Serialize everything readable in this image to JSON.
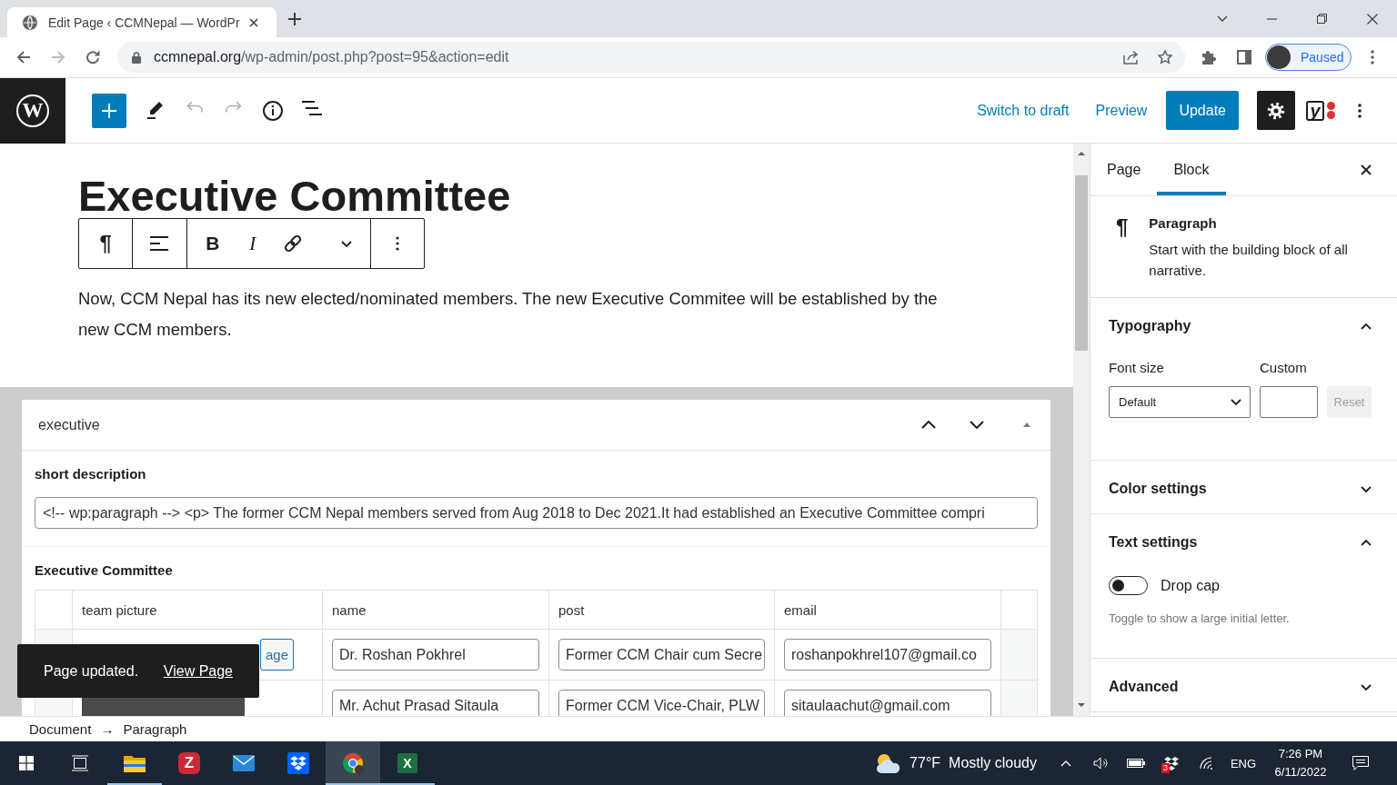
{
  "browser": {
    "tabs": [
      {
        "title": "Edit Page ‹ CCMNepal — WordPr",
        "selected": true
      }
    ],
    "nav": [
      {
        "kind": "back",
        "disabled": false
      },
      {
        "kind": "forward",
        "disabled": true
      },
      {
        "kind": "reload",
        "disabled": false
      }
    ],
    "address": {
      "domain": "ccmnepal.org",
      "path": "/wp-admin/post.php?post=95&action=edit"
    },
    "profile": {
      "label": "Paused"
    }
  },
  "editor_header": {
    "logo_glyph": "W",
    "history": [
      {
        "kind": "undo",
        "disabled": true
      },
      {
        "kind": "redo",
        "disabled": true
      }
    ],
    "links": [
      "Switch to draft",
      "Preview"
    ],
    "update_button": "Update",
    "settings_pressed": true,
    "seo_glyph": "y"
  },
  "block_toolbar": {
    "block_glyph": "¶",
    "bold_glyph": "B",
    "italic_glyph": "I"
  },
  "content": {
    "title": "Executive Committee",
    "paragraph": "Now, CCM Nepal has its new elected/nominated members. The new Executive Commitee will be established by the new CCM members."
  },
  "meta_box": {
    "title": "executive",
    "expanded": true,
    "short_description": {
      "label": "short description",
      "value": "<!-- wp:paragraph --> <p> The former CCM Nepal members served from Aug 2018 to Dec 2021.It had established an Executive Committee compri"
    },
    "repeater": {
      "label": "Executive Committee",
      "columns": [
        "team picture",
        "name",
        "post",
        "email"
      ],
      "rows": [
        {
          "image_button": "age",
          "name": "Dr. Roshan Pokhrel",
          "post": "Former CCM Chair cum Secre",
          "email": "roshanpokhrel107@gmail.co"
        },
        {
          "photo": true,
          "name": "Mr. Achut Prasad Sitaula",
          "post": "Former CCM Vice-Chair, PLW",
          "email": "sitaulaachut@gmail.com"
        }
      ]
    }
  },
  "snackbar": {
    "message": "Page updated.",
    "link": "View Page"
  },
  "sidebar": {
    "tabs": [
      {
        "label": "Page",
        "selected": false
      },
      {
        "label": "Block",
        "selected": true
      }
    ],
    "block_card": {
      "glyph": "¶",
      "title": "Paragraph",
      "description": "Start with the building block of all narrative."
    },
    "panels": [
      {
        "kind": "typography",
        "title": "Typography",
        "expanded": true,
        "font_size_label": "Font size",
        "font_size_value": "Default",
        "custom_label": "Custom",
        "reset_button": "Reset",
        "reset_disabled": true
      },
      {
        "kind": "plain",
        "title": "Color settings",
        "expanded": false
      },
      {
        "kind": "text",
        "title": "Text settings",
        "expanded": true,
        "toggle_label": "Drop cap",
        "toggle_on": false,
        "help": "Toggle to show a large initial letter."
      },
      {
        "kind": "plain",
        "title": "Advanced",
        "expanded": false
      }
    ]
  },
  "status_bar": {
    "breadcrumbs": [
      "Document",
      "Paragraph"
    ],
    "separator": "→"
  },
  "taskbar": {
    "apps": [
      {
        "kind": "explorer",
        "running": true,
        "active": false
      },
      {
        "kind": "zotero",
        "glyph": "Z",
        "running": false,
        "active": false
      },
      {
        "kind": "mail",
        "running": false,
        "active": false
      },
      {
        "kind": "dropbox",
        "running": false,
        "active": false
      },
      {
        "kind": "chrome",
        "running": true,
        "active": true
      },
      {
        "kind": "excel",
        "glyph": "X",
        "running": true,
        "active": false
      }
    ],
    "weather": {
      "temperature": "77°F",
      "condition": "Mostly cloudy"
    },
    "dropbox_badge": "3",
    "language": "ENG",
    "time": "7:26 PM",
    "date": "6/11/2022"
  }
}
